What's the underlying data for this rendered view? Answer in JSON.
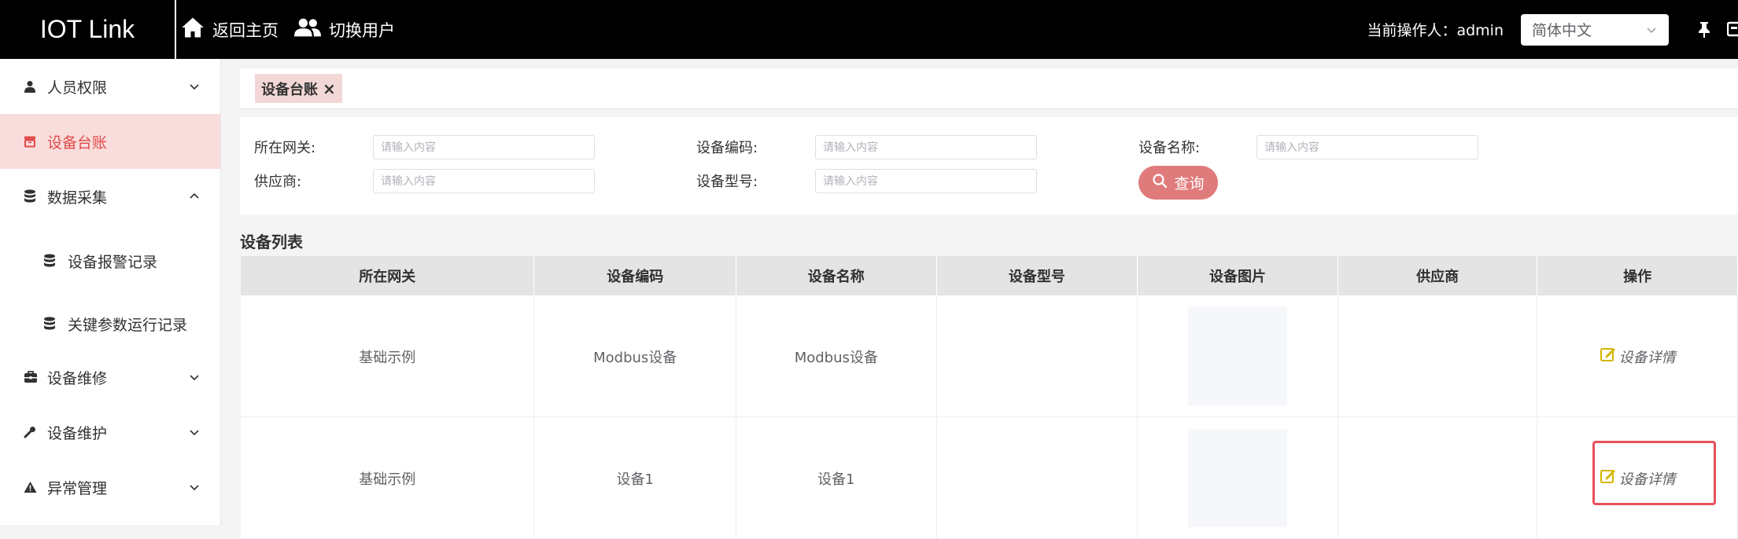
{
  "app": {
    "title": "IOT Link"
  },
  "header": {
    "nav": [
      {
        "label": "返回主页",
        "icon": "home-icon"
      },
      {
        "label": "切换用户",
        "icon": "users-icon"
      }
    ],
    "operator_label": "当前操作人：admin",
    "language": "简体中文"
  },
  "sidebar": {
    "items": [
      {
        "label": "人员权限",
        "icon": "user-icon",
        "arrow": "down"
      },
      {
        "label": "设备台账",
        "icon": "box-icon",
        "active": true
      },
      {
        "label": "数据采集",
        "icon": "database-icon",
        "arrow": "up"
      },
      {
        "label": "设备报警记录",
        "icon": "database-icon",
        "sub": true
      },
      {
        "label": "关键参数运行记录",
        "icon": "database-icon",
        "sub": true
      },
      {
        "label": "设备维修",
        "icon": "toolbox-icon",
        "arrow": "down"
      },
      {
        "label": "设备维护",
        "icon": "wrench-icon",
        "arrow": "down"
      },
      {
        "label": "异常管理",
        "icon": "warning-icon",
        "arrow": "down"
      }
    ]
  },
  "tags": [
    {
      "label": "设备台账",
      "close": "×"
    }
  ],
  "filter": {
    "gateway_label": "所在网关:",
    "code_label": "设备编码:",
    "name_label": "设备名称:",
    "supplier_label": "供应商:",
    "model_label": "设备型号:",
    "placeholder": "请输入内容",
    "query_label": "查询"
  },
  "list": {
    "title": "设备列表",
    "columns": [
      "所在网关",
      "设备编码",
      "设备名称",
      "设备型号",
      "设备图片",
      "供应商",
      "操作"
    ],
    "rows": [
      {
        "gateway": "基础示例",
        "code": "Modbus设备",
        "name": "Modbus设备",
        "model": "",
        "supplier": "",
        "action": "设备详情"
      },
      {
        "gateway": "基础示例",
        "code": "设备1",
        "name": "设备1",
        "model": "",
        "supplier": "",
        "action": "设备详情"
      }
    ]
  },
  "colors": {
    "accent": "#e04b4b",
    "active_bg": "#f9dcdc",
    "button": "#e07b7b",
    "edit_icon": "#d4b600"
  }
}
